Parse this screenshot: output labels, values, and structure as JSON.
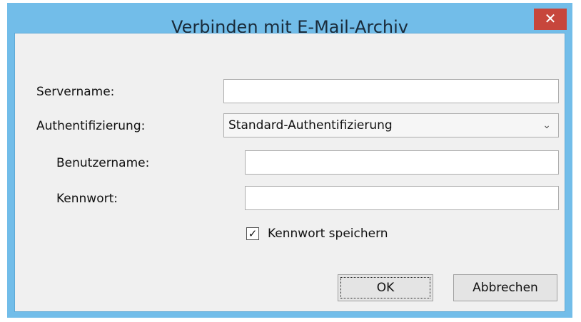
{
  "dialog": {
    "title": "Verbinden mit E-Mail-Archiv",
    "close_symbol": "✕"
  },
  "form": {
    "servername_label": "Servername:",
    "servername_value": "",
    "auth_label": "Authentifizierung:",
    "auth_value": "Standard-Authentifizierung",
    "username_label": "Benutzername:",
    "username_value": "",
    "password_label": "Kennwort:",
    "password_value": "",
    "save_password_label": "Kennwort speichern",
    "save_password_checked": true
  },
  "buttons": {
    "ok_label": "OK",
    "cancel_label": "Abbrechen"
  },
  "icons": {
    "close": "close-icon",
    "dropdown": "chevron-down-icon",
    "check": "checkmark-icon"
  },
  "colors": {
    "titlebar": "#72bde9",
    "close_button": "#c7463c",
    "client": "#f0f0f0"
  }
}
